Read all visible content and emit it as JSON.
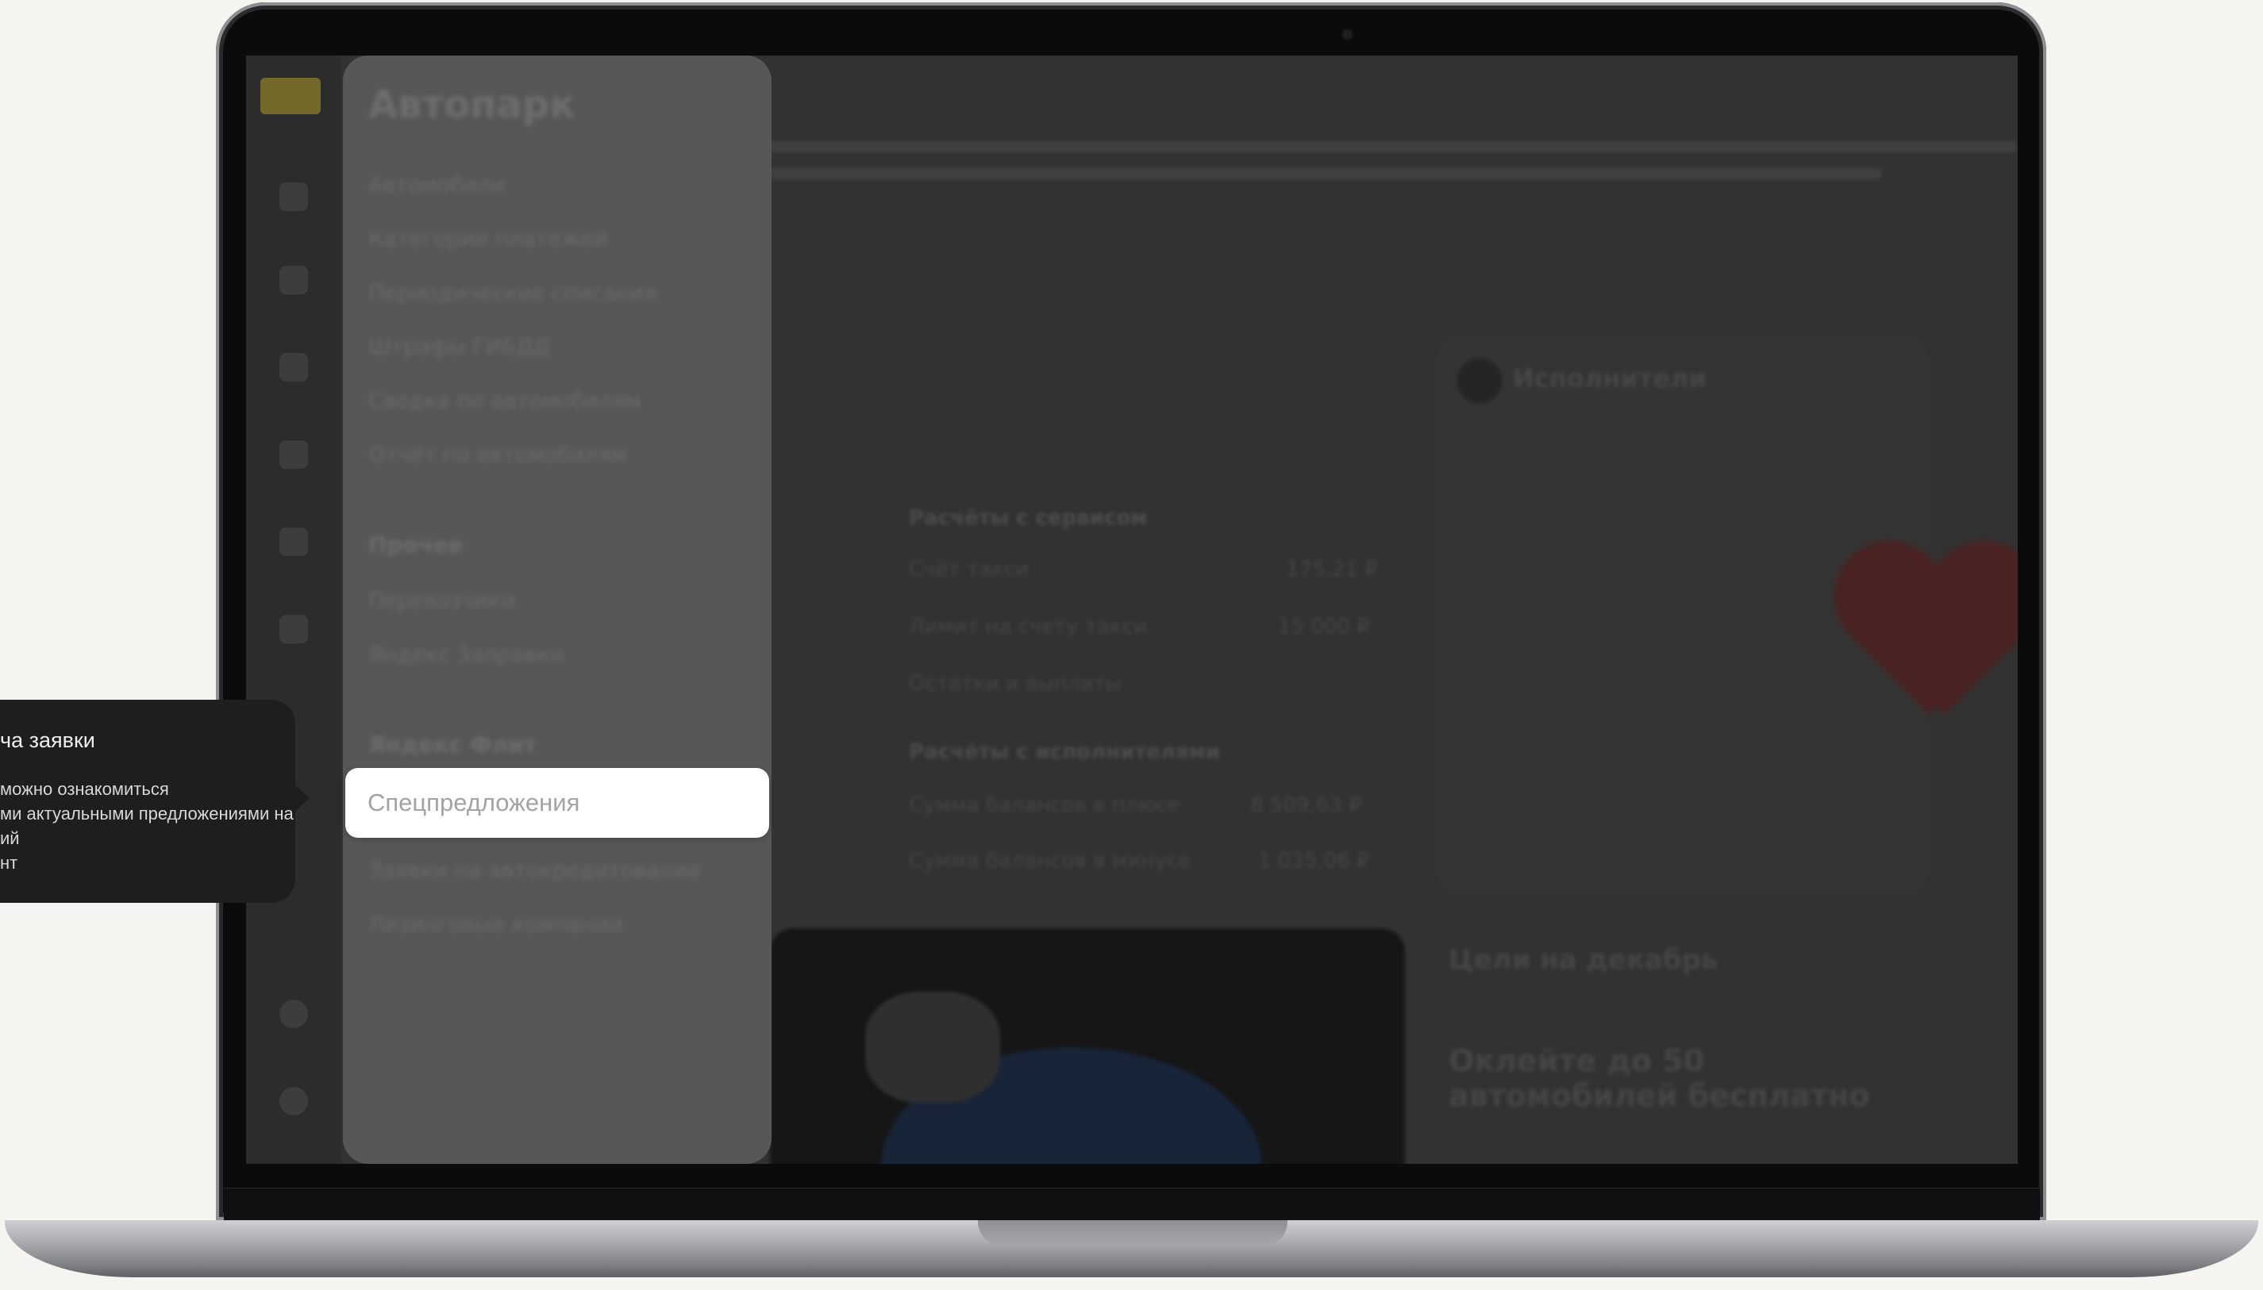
{
  "panel": {
    "title": "Автопарк",
    "items": [
      "Автомобили",
      "Категории платежей",
      "Периодические списания",
      "Штрафы ГИБДД",
      "Сводка по автомобилям",
      "Отчёт по автомобилям"
    ],
    "section_other": "Прочее",
    "other_items": [
      "Перевозчики",
      "Яндекс Заправки"
    ],
    "section_fleet": "Яндекс Флит",
    "fleet_items": [
      "Заявки на автокредитование",
      "Лизинговые компании"
    ]
  },
  "highlighted_item": "Спецпредложения",
  "tooltip": {
    "title": "ча заявки",
    "lines": [
      "можно ознакомиться",
      "ми актуальными предложениями на",
      "ий",
      "нт"
    ]
  },
  "right_card": {
    "title": "Исполнители"
  },
  "middle": {
    "section1": "Расчёты с сервисом",
    "row1": "Счёт такси",
    "row2": "Лимит на счету такси",
    "row3": "Остатки и выплаты",
    "section2": "Расчёты с исполнителями",
    "row4": "Сумма балансов в плюсе",
    "row5": "Сумма балансов в минусе",
    "val1": "175,21 ₽",
    "val2": "15 000 ₽",
    "val4": "8 509,63 ₽",
    "val5": "1 035,06 ₽"
  },
  "goals": {
    "title": "Цели на декабрь",
    "headline": "Оклейте до 50 автомобилей бесплатно"
  }
}
